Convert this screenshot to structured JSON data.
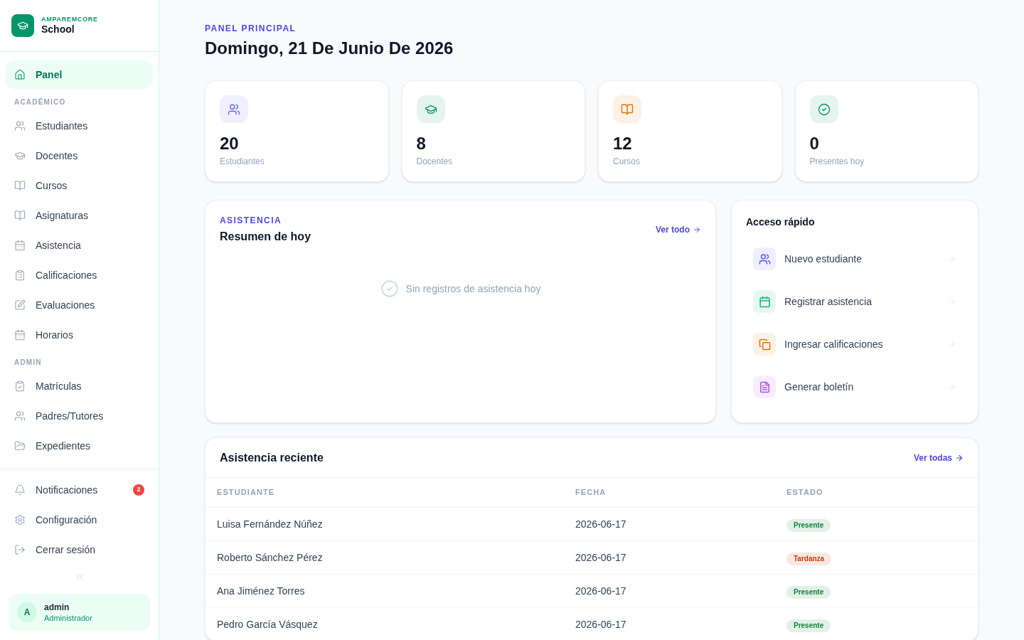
{
  "sidebar": {
    "brand": {
      "overline": "AMPAREMCORE",
      "name": "School"
    },
    "sections": [
      {
        "items": [
          {
            "label": "Panel",
            "selected": true
          }
        ]
      },
      {
        "heading": "ACADÉMICO",
        "items": [
          {
            "label": "Estudiantes",
            "selected": false
          },
          {
            "label": "Docentes",
            "selected": false
          },
          {
            "label": "Cursos",
            "selected": false
          },
          {
            "label": "Asignaturas",
            "selected": false
          },
          {
            "label": "Asistencia",
            "selected": false
          },
          {
            "label": "Calificaciones",
            "selected": false
          },
          {
            "label": "Evaluaciones",
            "selected": false
          },
          {
            "label": "Horarios",
            "selected": false
          }
        ]
      },
      {
        "heading": "ADMIN",
        "items": [
          {
            "label": "Matrículas",
            "selected": false
          },
          {
            "label": "Padres/Tutores",
            "selected": false
          },
          {
            "label": "Expedientes",
            "selected": false
          }
        ]
      }
    ],
    "footer_items": [
      {
        "label": "Notificaciones",
        "badge": "2",
        "selected": false
      },
      {
        "label": "Configuración",
        "selected": false
      },
      {
        "label": "Cerrar sesión",
        "selected": false
      }
    ],
    "user": {
      "initial": "A",
      "name": "admin",
      "role": "Administrador"
    }
  },
  "header": {
    "overline": "PANEL PRINCIPAL",
    "title": "Domingo, 21 De Junio De 2026"
  },
  "stats": [
    {
      "value": "20",
      "label": "Estudiantes",
      "color": "#6366f1"
    },
    {
      "value": "8",
      "label": "Docentes",
      "color": "#059669"
    },
    {
      "value": "12",
      "label": "Cursos",
      "color": "#d97706"
    },
    {
      "value": "0",
      "label": "Presentes hoy",
      "color": "#059669"
    }
  ],
  "attendance_summary": {
    "overline": "ASISTENCIA",
    "title": "Resumen de hoy",
    "link": "Ver todo",
    "empty_message": "Sin registros de asistencia hoy"
  },
  "quick_access": {
    "title": "Acceso rápido",
    "items": [
      {
        "label": "Nuevo estudiante",
        "color": "#6366f1"
      },
      {
        "label": "Registrar asistencia",
        "color": "#10b981"
      },
      {
        "label": "Ingresar calificaciones",
        "color": "#d97706"
      },
      {
        "label": "Generar boletín",
        "color": "#a855f7"
      }
    ]
  },
  "recent_attendance": {
    "title": "Asistencia reciente",
    "link": "Ver todas",
    "columns": [
      "ESTUDIANTE",
      "FECHA",
      "ESTADO"
    ],
    "rows": [
      {
        "student": "Luisa Fernández Núñez",
        "date": "2026-06-17",
        "status": "Presente",
        "color": "#15803d"
      },
      {
        "student": "Roberto Sánchez Pérez",
        "date": "2026-06-17",
        "status": "Tardanza",
        "color": "#c2410c"
      },
      {
        "student": "Ana Jiménez Torres",
        "date": "2026-06-17",
        "status": "Presente",
        "color": "#15803d"
      },
      {
        "student": "Pedro García Vásquez",
        "date": "2026-06-17",
        "status": "Presente",
        "color": "#15803d"
      }
    ]
  }
}
